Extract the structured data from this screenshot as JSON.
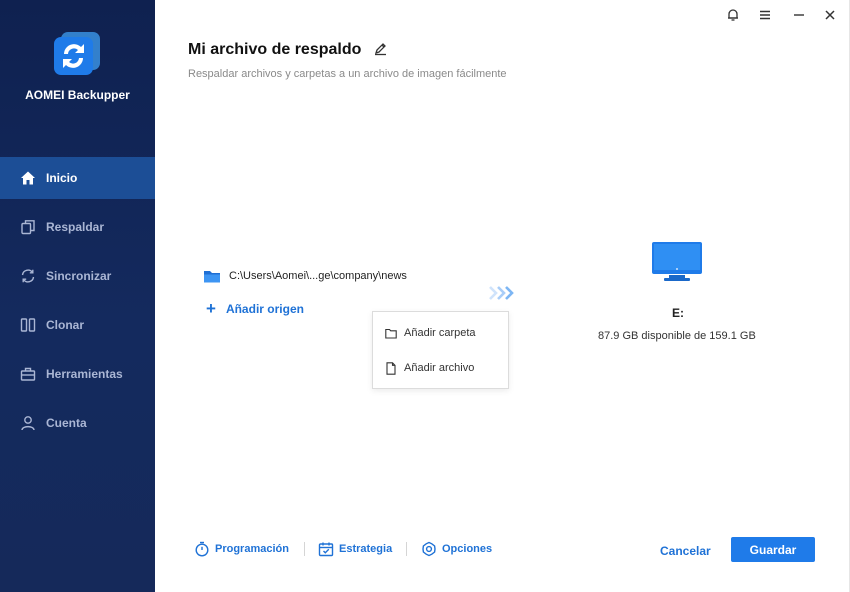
{
  "app": {
    "name": "AOMEI Backupper"
  },
  "sidebar": {
    "items": [
      {
        "label": "Inicio",
        "icon": "home-icon",
        "active": true
      },
      {
        "label": "Respaldar",
        "icon": "copy-icon",
        "active": false
      },
      {
        "label": "Sincronizar",
        "icon": "sync-icon",
        "active": false
      },
      {
        "label": "Clonar",
        "icon": "clone-icon",
        "active": false
      },
      {
        "label": "Herramientas",
        "icon": "toolbox-icon",
        "active": false
      },
      {
        "label": "Cuenta",
        "icon": "user-icon",
        "active": false
      }
    ]
  },
  "window_controls": [
    "bell-icon",
    "menu-icon",
    "minimize-icon",
    "close-icon"
  ],
  "header": {
    "title": "Mi archivo de respaldo",
    "subtitle": "Respaldar archivos y carpetas a un archivo de imagen fácilmente"
  },
  "source": {
    "path": "C:\\Users\\Aomei\\...ge\\company\\news",
    "add_label": "Añadir origen"
  },
  "dropdown": {
    "items": [
      {
        "label": "Añadir carpeta",
        "icon": "folder-outline-icon"
      },
      {
        "label": "Añadir archivo",
        "icon": "file-outline-icon"
      }
    ]
  },
  "destination": {
    "drive": "E:",
    "space": "87.9 GB disponible de 159.1 GB"
  },
  "footer": {
    "schedule_label": "Programación",
    "strategy_label": "Estrategia",
    "options_label": "Opciones",
    "cancel_label": "Cancelar",
    "save_label": "Guardar"
  },
  "colors": {
    "sidebar_bg": "#132659",
    "sidebar_active": "#1c4e96",
    "accent": "#1f7be9",
    "link": "#1f72d6"
  }
}
